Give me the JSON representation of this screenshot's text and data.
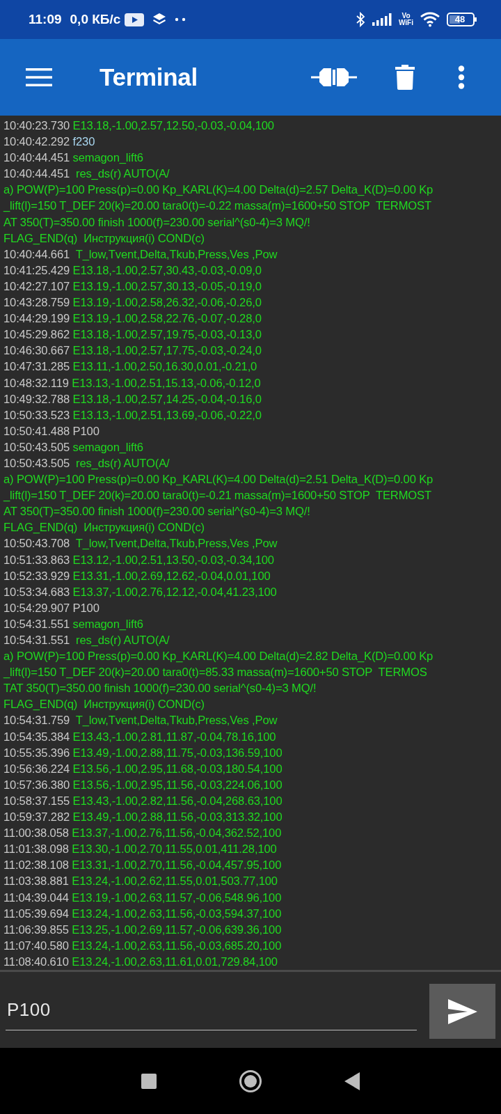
{
  "status_bar": {
    "time": "11:09",
    "speed": "0,0 КБ/с",
    "volte_top": "Vo",
    "volte_bottom": "WiFi",
    "battery": "48"
  },
  "toolbar": {
    "title": "Terminal"
  },
  "log": [
    {
      "time": "10:40:23.730",
      "kind": "received",
      "text": "E13.18,-1.00,2.57,12.50,-0.03,-0.04,100"
    },
    {
      "time": "10:40:42.292",
      "kind": "sent",
      "text": "f230"
    },
    {
      "time": "10:40:44.451",
      "kind": "received",
      "text": "semagon_lift6"
    },
    {
      "time": "10:40:44.451",
      "kind": "received",
      "text": " res_ds(r) AUTO(A/",
      "continuation": [
        "a) POW(P)=100 Press(p)=0.00 Kp_KARL(K)=4.00 Delta(d)=2.57 Delta_K(D)=0.00 Kp",
        "_lift(l)=150 T_DEF 20(k)=20.00 tara0(t)=-0.22 massa(m)=1600+50 STOP  TERMOST",
        "AT 350(T)=350.00 finish 1000(f)=230.00 serial^(s0-4)=3 MQ/!",
        "FLAG_END(q)  Инструкция(i) COND(c)"
      ]
    },
    {
      "time": "10:40:44.661",
      "kind": "received",
      "text": " T_low,Tvent,Delta,Tkub,Press,Ves ,Pow"
    },
    {
      "time": "10:41:25.429",
      "kind": "received",
      "text": "E13.18,-1.00,2.57,30.43,-0.03,-0.09,0"
    },
    {
      "time": "10:42:27.107",
      "kind": "received",
      "text": "E13.19,-1.00,2.57,30.13,-0.05,-0.19,0"
    },
    {
      "time": "10:43:28.759",
      "kind": "received",
      "text": "E13.19,-1.00,2.58,26.32,-0.06,-0.26,0"
    },
    {
      "time": "10:44:29.199",
      "kind": "received",
      "text": "E13.19,-1.00,2.58,22.76,-0.07,-0.28,0"
    },
    {
      "time": "10:45:29.862",
      "kind": "received",
      "text": "E13.18,-1.00,2.57,19.75,-0.03,-0.13,0"
    },
    {
      "time": "10:46:30.667",
      "kind": "received",
      "text": "E13.18,-1.00,2.57,17.75,-0.03,-0.24,0"
    },
    {
      "time": "10:47:31.285",
      "kind": "received",
      "text": "E13.11,-1.00,2.50,16.30,0.01,-0.21,0"
    },
    {
      "time": "10:48:32.119",
      "kind": "received",
      "text": "E13.13,-1.00,2.51,15.13,-0.06,-0.12,0"
    },
    {
      "time": "10:49:32.788",
      "kind": "received",
      "text": "E13.18,-1.00,2.57,14.25,-0.04,-0.16,0"
    },
    {
      "time": "10:50:33.523",
      "kind": "received",
      "text": "E13.13,-1.00,2.51,13.69,-0.06,-0.22,0"
    },
    {
      "time": "10:50:41.488",
      "kind": "typed",
      "text": "P100"
    },
    {
      "time": "10:50:43.505",
      "kind": "received",
      "text": "semagon_lift6"
    },
    {
      "time": "10:50:43.505",
      "kind": "received",
      "text": " res_ds(r) AUTO(A/",
      "continuation": [
        "a) POW(P)=100 Press(p)=0.00 Kp_KARL(K)=4.00 Delta(d)=2.51 Delta_K(D)=0.00 Kp",
        "_lift(l)=150 T_DEF 20(k)=20.00 tara0(t)=-0.21 massa(m)=1600+50 STOP  TERMOST",
        "AT 350(T)=350.00 finish 1000(f)=230.00 serial^(s0-4)=3 MQ/!",
        "FLAG_END(q)  Инструкция(i) COND(c)"
      ]
    },
    {
      "time": "10:50:43.708",
      "kind": "received",
      "text": " T_low,Tvent,Delta,Tkub,Press,Ves ,Pow"
    },
    {
      "time": "10:51:33.863",
      "kind": "received",
      "text": "E13.12,-1.00,2.51,13.50,-0.03,-0.34,100"
    },
    {
      "time": "10:52:33.929",
      "kind": "received",
      "text": "E13.31,-1.00,2.69,12.62,-0.04,0.01,100"
    },
    {
      "time": "10:53:34.683",
      "kind": "received",
      "text": "E13.37,-1.00,2.76,12.12,-0.04,41.23,100"
    },
    {
      "time": "10:54:29.907",
      "kind": "typed",
      "text": "P100"
    },
    {
      "time": "10:54:31.551",
      "kind": "received",
      "text": "semagon_lift6"
    },
    {
      "time": "10:54:31.551",
      "kind": "received",
      "text": " res_ds(r) AUTO(A/",
      "continuation": [
        "a) POW(P)=100 Press(p)=0.00 Kp_KARL(K)=4.00 Delta(d)=2.82 Delta_K(D)=0.00 Kp",
        "_lift(l)=150 T_DEF 20(k)=20.00 tara0(t)=85.33 massa(m)=1600+50 STOP  TERMOS",
        "TAT 350(T)=350.00 finish 1000(f)=230.00 serial^(s0-4)=3 MQ/!",
        "FLAG_END(q)  Инструкция(i) COND(c)"
      ]
    },
    {
      "time": "10:54:31.759",
      "kind": "received",
      "text": " T_low,Tvent,Delta,Tkub,Press,Ves ,Pow"
    },
    {
      "time": "10:54:35.384",
      "kind": "received",
      "text": "E13.43,-1.00,2.81,11.87,-0.04,78.16,100"
    },
    {
      "time": "10:55:35.396",
      "kind": "received",
      "text": "E13.49,-1.00,2.88,11.75,-0.03,136.59,100"
    },
    {
      "time": "10:56:36.224",
      "kind": "received",
      "text": "E13.56,-1.00,2.95,11.68,-0.03,180.54,100"
    },
    {
      "time": "10:57:36.380",
      "kind": "received",
      "text": "E13.56,-1.00,2.95,11.56,-0.03,224.06,100"
    },
    {
      "time": "10:58:37.155",
      "kind": "received",
      "text": "E13.43,-1.00,2.82,11.56,-0.04,268.63,100"
    },
    {
      "time": "10:59:37.282",
      "kind": "received",
      "text": "E13.49,-1.00,2.88,11.56,-0.03,313.32,100"
    },
    {
      "time": "11:00:38.058",
      "kind": "received",
      "text": "E13.37,-1.00,2.76,11.56,-0.04,362.52,100"
    },
    {
      "time": "11:01:38.098",
      "kind": "received",
      "text": "E13.30,-1.00,2.70,11.55,0.01,411.28,100"
    },
    {
      "time": "11:02:38.108",
      "kind": "received",
      "text": "E13.31,-1.00,2.70,11.56,-0.04,457.95,100"
    },
    {
      "time": "11:03:38.881",
      "kind": "received",
      "text": "E13.24,-1.00,2.62,11.55,0.01,503.77,100"
    },
    {
      "time": "11:04:39.044",
      "kind": "received",
      "text": "E13.19,-1.00,2.63,11.57,-0.06,548.96,100"
    },
    {
      "time": "11:05:39.694",
      "kind": "received",
      "text": "E13.24,-1.00,2.63,11.56,-0.03,594.37,100"
    },
    {
      "time": "11:06:39.855",
      "kind": "received",
      "text": "E13.25,-1.00,2.69,11.57,-0.06,639.36,100"
    },
    {
      "time": "11:07:40.580",
      "kind": "received",
      "text": "E13.24,-1.00,2.63,11.56,-0.03,685.20,100"
    },
    {
      "time": "11:08:40.610",
      "kind": "received",
      "text": "E13.24,-1.00,2.63,11.61,0.01,729.84,100"
    }
  ],
  "input": {
    "value": "P100"
  }
}
